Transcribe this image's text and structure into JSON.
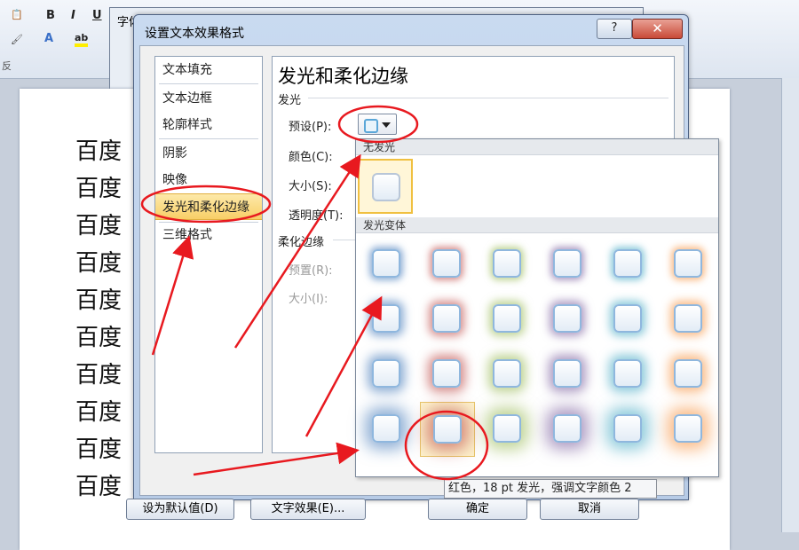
{
  "background_doc": {
    "back_dialog_title": "字体",
    "doc_char": "百度",
    "lines": [
      "百度",
      "百度",
      "百度",
      "百度",
      "百度",
      "百度",
      "百度",
      "百度",
      "百度",
      "百度"
    ],
    "ribbon_bold": "B",
    "ribbon_italic": "I",
    "ribbon_underline": "U",
    "ribbon_section": "反"
  },
  "dialog": {
    "title": "设置文本效果格式",
    "help": "?",
    "close": "✕",
    "nav": [
      {
        "label": "文本填充"
      },
      {
        "label": "文本边框"
      },
      {
        "label": "轮廓样式"
      },
      {
        "label": "阴影"
      },
      {
        "label": "映像"
      },
      {
        "label": "发光和柔化边缘",
        "selected": true
      },
      {
        "label": "三维格式"
      }
    ],
    "content": {
      "title": "发光和柔化边缘",
      "glow_section": "发光",
      "preset_label": "预设(P):",
      "color_label": "颜色(C):",
      "size_label": "大小(S):",
      "transparency_label": "透明度(T):",
      "soft_section": "柔化边缘",
      "soft_preset_label": "预置(R):",
      "soft_size_label": "大小(I):"
    },
    "buttons": {
      "set_default": "设为默认值(D)",
      "text_effects": "文字效果(E)...",
      "ok": "确定",
      "cancel": "取消"
    }
  },
  "gallery": {
    "no_glow_header": "无发光",
    "variants_header": "发光变体",
    "rows": 4,
    "colors": [
      "#4f81bd",
      "#c0504d",
      "#9bbb59",
      "#8064a2",
      "#4bacc6",
      "#f79646"
    ],
    "glow_sizes_pt": [
      5,
      8,
      11,
      18
    ],
    "hovered": {
      "row": 3,
      "col": 1
    },
    "tooltip": "红色，18 pt 发光，强调文字颜色 2"
  },
  "annotation_color": "#e8191f"
}
